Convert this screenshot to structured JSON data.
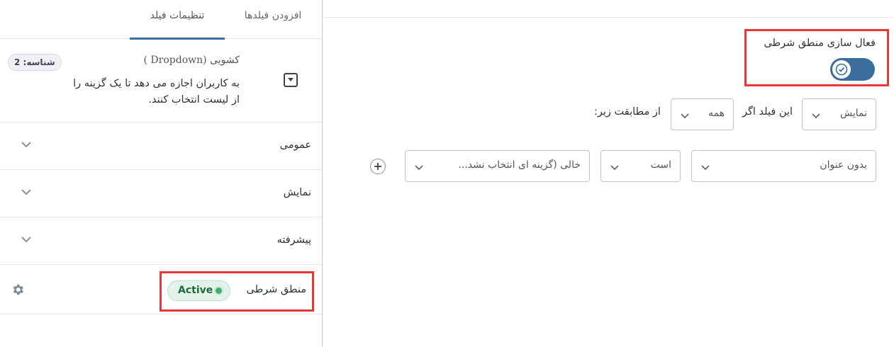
{
  "left_panel": {
    "tabs": {
      "add_fields": "افزودن فیلدها",
      "field_settings": "تنظیمات فیلد"
    },
    "field": {
      "id_badge": "شناسه: 2",
      "type_label": "کشویی (Dropdown )",
      "description": "به کاربران اجازه می دهد تا یک گزینه را از لیست انتخاب کنند.",
      "icon": "dropdown-field-icon"
    },
    "sections": {
      "general": "عمومی",
      "display": "نمایش",
      "advanced": "پیشرفته",
      "conditional_logic": "منطق شرطی"
    },
    "status_badge": "Active",
    "status_color": "#1d6b3b"
  },
  "right_panel": {
    "enable_logic_label": "فعال سازی منطق شرطی",
    "toggle_on": true,
    "toggle_color": "#3b6e9c",
    "action_select": "نمایش",
    "if_text": "این فیلد اگر",
    "match_select": "همه",
    "match_text": "از مطابقت زیر:",
    "rule": {
      "field_select": "بدون عنوان",
      "operator_select": "است",
      "value_select": "خالی (گزینه ای انتخاب نشد..."
    }
  },
  "highlight_color": "#e53935"
}
